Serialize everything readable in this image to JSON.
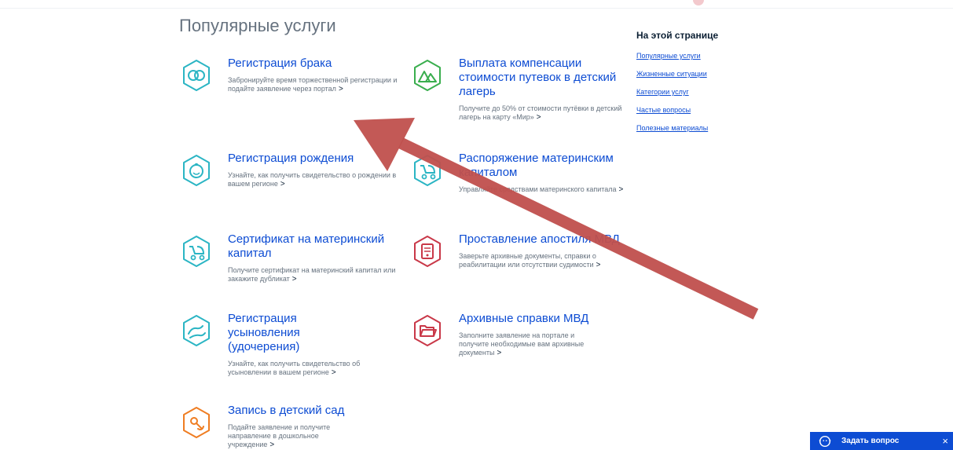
{
  "section_title": "Популярные услуги",
  "services": [
    {
      "title": "Регистрация брака",
      "desc": "Забронируйте время торжественной регистрации и подайте заявление через портал",
      "icon": "rings-icon",
      "color": "#2bb5c4"
    },
    {
      "title": "Выплата компенсации стоимости путевок в детский лагерь",
      "desc": "Получите до 50% от стоимости путёвки в детский лагерь на карту «Мир»",
      "icon": "camp-tents-icon",
      "color": "#3aae4e"
    },
    {
      "title": "Регистрация рождения",
      "desc": "Узнайте, как получить свидетельство о рождении в вашем регионе",
      "icon": "baby-face-icon",
      "color": "#2bb5c4"
    },
    {
      "title": "Распоряжение материнским капиталом",
      "desc": "Управляйте средствами материнского капитала",
      "icon": "stroller-icon",
      "color": "#2bb5c4"
    },
    {
      "title": "Сертификат на материнский капитал",
      "desc": "Получите сертификат на материнский капитал или закажите дубликат",
      "icon": "stroller-icon",
      "color": "#2bb5c4"
    },
    {
      "title": "Проставление апостиля МВД",
      "desc": "Заверьте архивные документы, справки о реабилитации или отсутствии судимости",
      "icon": "document-icon",
      "color": "#c93848"
    },
    {
      "title": "Регистрация усыновления (удочерения)",
      "desc": "Узнайте, как получить свидетельство об усыновлении в вашем регионе",
      "icon": "hands-icon",
      "color": "#2bb5c4"
    },
    {
      "title": "Архивные справки МВД",
      "desc": "Заполните заявление на портале и получите необходимые вам архивные документы",
      "icon": "folder-icon",
      "color": "#c93848"
    },
    {
      "title": "Запись в детский сад",
      "desc": "Подайте заявление и получите направление в дошкольное учреждение",
      "icon": "pacifier-icon",
      "color": "#ef7d22"
    }
  ],
  "chevron": ">",
  "aside": {
    "heading": "На этой странице",
    "links": [
      "Популярные услуги",
      "Жизненные ситуации",
      "Категории услуг",
      "Частые вопросы",
      "Полезные материалы"
    ]
  },
  "ask_button": {
    "label": "Задать вопрос",
    "close": "×",
    "icon": "support-agent-icon"
  },
  "annotation": {
    "color": "#c0504d",
    "icon": "pointer-arrow"
  }
}
